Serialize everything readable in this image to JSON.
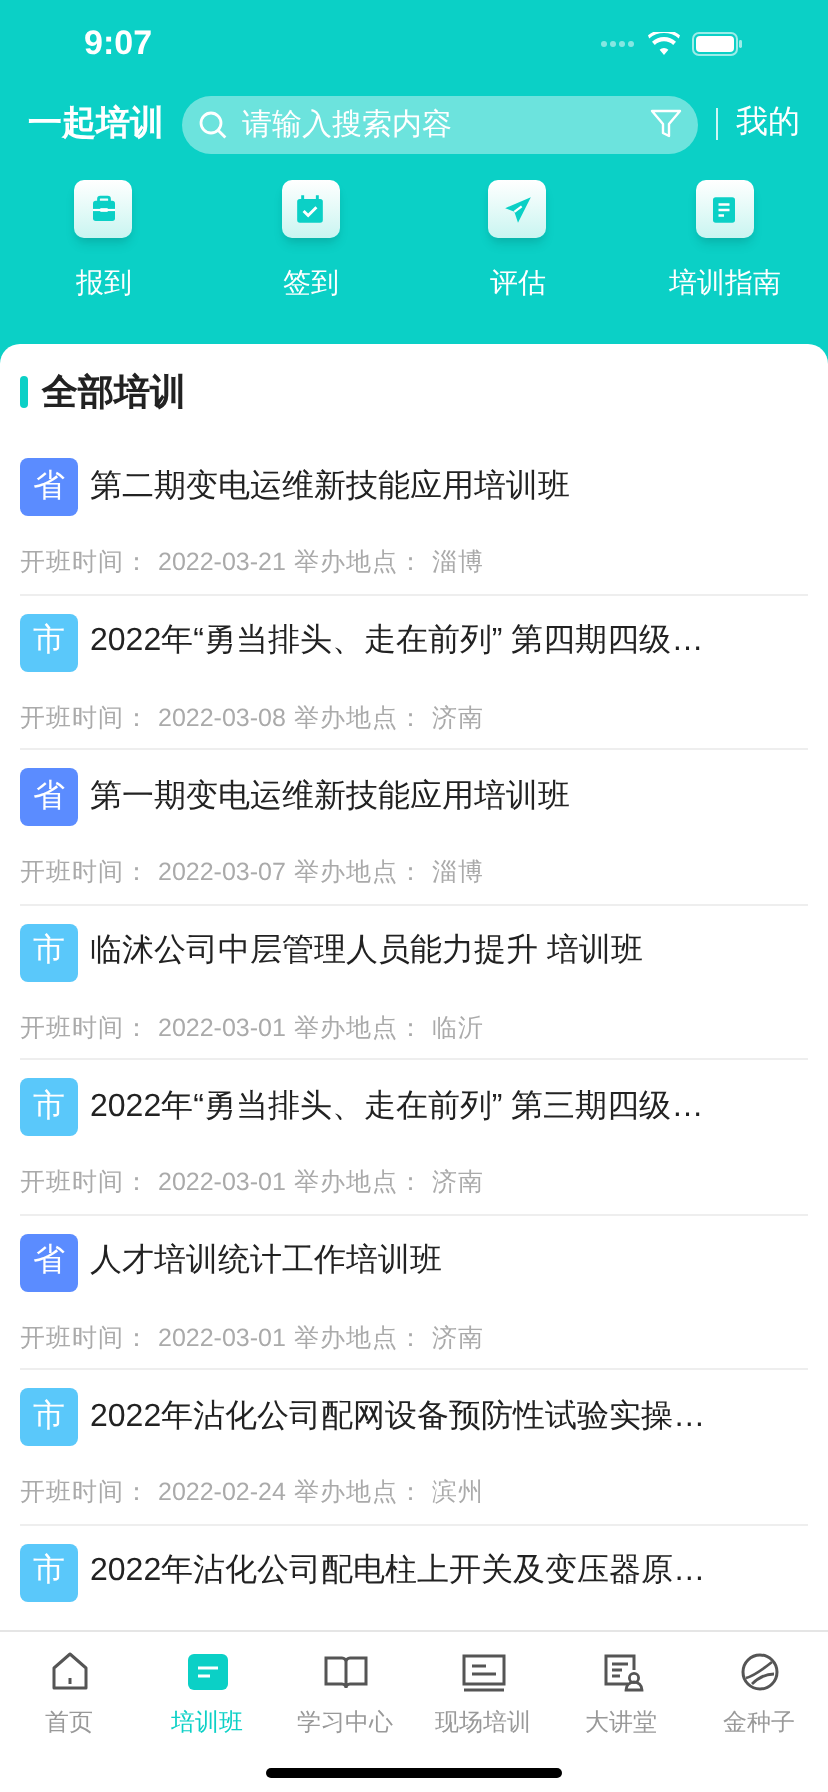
{
  "status_bar": {
    "time": "9:07"
  },
  "header": {
    "title": "一起培训",
    "search": {
      "placeholder": "请输入搜索内容"
    },
    "profile_link": "我的"
  },
  "shortcuts": [
    {
      "kind": "checkin",
      "label": "报到"
    },
    {
      "kind": "signin",
      "label": "签到"
    },
    {
      "kind": "evaluate",
      "label": "评估"
    },
    {
      "kind": "guide",
      "label": "培训指南"
    }
  ],
  "section_title": "全部培训",
  "trainings": [
    {
      "level": "省",
      "color": "#5b8cff",
      "title": "第二期变电运维新技能应用培训班",
      "date_label": "开班时间：",
      "date": "2022-03-21",
      "place_label": "举办地点：",
      "place": "淄博"
    },
    {
      "level": "市",
      "color": "#5ac8fa",
      "title": "2022年“勇当排头、走在前列” 第四期四级…",
      "date_label": "开班时间：",
      "date": "2022-03-08",
      "place_label": "举办地点：",
      "place": "济南"
    },
    {
      "level": "省",
      "color": "#5b8cff",
      "title": "第一期变电运维新技能应用培训班",
      "date_label": "开班时间：",
      "date": "2022-03-07",
      "place_label": "举办地点：",
      "place": "淄博"
    },
    {
      "level": "市",
      "color": "#5ac8fa",
      "title": "临沭公司中层管理人员能力提升 培训班",
      "date_label": "开班时间：",
      "date": "2022-03-01",
      "place_label": "举办地点：",
      "place": "临沂"
    },
    {
      "level": "市",
      "color": "#5ac8fa",
      "title": "2022年“勇当排头、走在前列” 第三期四级…",
      "date_label": "开班时间：",
      "date": "2022-03-01",
      "place_label": "举办地点：",
      "place": "济南"
    },
    {
      "level": "省",
      "color": "#5b8cff",
      "title": "人才培训统计工作培训班",
      "date_label": "开班时间：",
      "date": "2022-03-01",
      "place_label": "举办地点：",
      "place": "济南"
    },
    {
      "level": "市",
      "color": "#5ac8fa",
      "title": "2022年沾化公司配网设备预防性试验实操…",
      "date_label": "开班时间：",
      "date": "2022-02-24",
      "place_label": "举办地点：",
      "place": "滨州"
    },
    {
      "level": "市",
      "color": "#5ac8fa",
      "title": "2022年沾化公司配电柱上开关及变压器原…"
    }
  ],
  "tab_bar": [
    {
      "kind": "home",
      "label": "首页",
      "selected": false
    },
    {
      "kind": "class",
      "label": "培训班",
      "selected": true
    },
    {
      "kind": "study",
      "label": "学习中心",
      "selected": false
    },
    {
      "kind": "onsite",
      "label": "现场培训",
      "selected": false
    },
    {
      "kind": "lecture",
      "label": "大讲堂",
      "selected": false
    },
    {
      "kind": "seed",
      "label": "金种子",
      "selected": false
    }
  ]
}
